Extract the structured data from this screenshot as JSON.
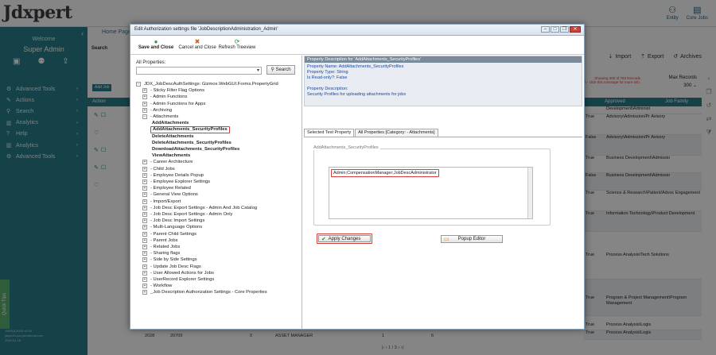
{
  "app": {
    "logo": "Jdxpert",
    "top_right": [
      {
        "icon": "entity-icon",
        "label": "Entity"
      },
      {
        "icon": "core-jobs-icon",
        "label": "Core Jobs"
      }
    ]
  },
  "sidebar": {
    "welcome": "Welcome",
    "user": "Super Admin",
    "menu": [
      {
        "label": "Advanced Tools"
      },
      {
        "label": "Actions"
      },
      {
        "label": "Search"
      },
      {
        "label": "Analytics"
      },
      {
        "label": "Help"
      },
      {
        "label": "Analytics"
      },
      {
        "label": "Advanced Tools"
      }
    ],
    "quick_tips": "Quick Tips",
    "footer": [
      "VMSQL2008 v0.00",
      "jdxpert1.jdx.jdxinternal.com",
      "2024.01.18"
    ]
  },
  "main": {
    "home_tab": "Home Page",
    "search_label": "Search",
    "add_job": "Add Job",
    "tools": [
      "Import",
      "Export",
      "Archives"
    ],
    "warning": [
      "Showing 300 of 783 Records",
      "ystem - click this message for more info."
    ],
    "max_records_label": "Max Records",
    "max_records_value": "300",
    "table_head": {
      "action": "Action",
      "approved": "Approved",
      "job_family": "Job Family"
    },
    "grid_right": [
      {
        "approved": "",
        "family": "Development\\Administ"
      },
      {
        "approved": "True",
        "family": "Advisory\\Admission/Pr Avisory"
      },
      {
        "approved": "False",
        "family": "Advisory\\Admission/Pr Avisory"
      },
      {
        "approved": "True",
        "family": "Business Development\\Admissio"
      },
      {
        "approved": "False",
        "family": "Business Development\\Admissio"
      },
      {
        "approved": "True",
        "family": "Science & Research\\Patient/Advoc Engagement"
      },
      {
        "approved": "True",
        "family": "Information Technology\\Product Development"
      },
      {
        "approved": "True",
        "family": "Process Analysis\\Tech Solutions"
      },
      {
        "approved": "True",
        "family": "Program & Project Management\\Program Management"
      },
      {
        "approved": "True",
        "family": "Process Analysis\\Logis"
      },
      {
        "approved": "True",
        "family": "Process Analysis\\Logis"
      }
    ],
    "bottom_row": {
      "c1": "2028",
      "c2": "20709",
      "c3": "0",
      "c4": "ASSET MANAGER",
      "c5": "1",
      "c6": "6"
    },
    "pager": "1 / 3"
  },
  "dialog": {
    "title": "Edit Authorization settings file 'JobDescriptionAdministration_Admin'",
    "toolbar": [
      {
        "icon": "save-icon",
        "label": "Save and Close"
      },
      {
        "icon": "cancel-icon",
        "label": "Cancel and Close"
      },
      {
        "icon": "refresh-icon",
        "label": "Refresh Treeview"
      }
    ],
    "all_properties_label": "All Properties:",
    "search_button": "Search",
    "tree_root": "JDX_JobDescAuthSettings: Gizmox.WebGUI.Forms.PropertyGrid",
    "tree": [
      {
        "label": "- Sticky Filter Flag Options"
      },
      {
        "label": "- Admin Functions"
      },
      {
        "label": "- Admin Functions for Apps"
      },
      {
        "label": "- Archiving"
      },
      {
        "label": "- Attachments"
      },
      {
        "label": "AddAttachments"
      },
      {
        "label": "AddAttachments_SecurityProfiles"
      },
      {
        "label": "DeleteAttachments"
      },
      {
        "label": "DeleteAttachments_SecurityProfiles"
      },
      {
        "label": "DownloadAttachments_SecurityProfiles"
      },
      {
        "label": "ViewAttachments"
      },
      {
        "label": "- Career Architecture"
      },
      {
        "label": "- Child Jobs"
      },
      {
        "label": "- Employee Details Popup"
      },
      {
        "label": "- Employee Explorer Settings"
      },
      {
        "label": "- Employee Related"
      },
      {
        "label": "- General View Options"
      },
      {
        "label": "- Import/Export"
      },
      {
        "label": "- Job Desc Export Settings - Admin And Job Catalog"
      },
      {
        "label": "- Job Desc Export Settings - Admin Only"
      },
      {
        "label": "- Job Desc Import Settings"
      },
      {
        "label": "- Multi-Language Options"
      },
      {
        "label": "- Parent Child Settings"
      },
      {
        "label": "- Parent Jobs"
      },
      {
        "label": "- Related Jobs"
      },
      {
        "label": "- Sharing flags"
      },
      {
        "label": "- Side by Side Settings"
      },
      {
        "label": "- Update Job Desc Flags"
      },
      {
        "label": "- User Allowed Actions for Jobs"
      },
      {
        "label": "- UserRecord Explorer Settings"
      },
      {
        "label": "- Workflow"
      },
      {
        "label": "_Job Description Authorization Settings - Core Properties"
      }
    ],
    "description": {
      "header": "Property Description for 'AddAttachments_SecurityProfiles'",
      "lines": [
        "Property Name: AddAttachments_SecurityProfiles",
        "Property Type: String",
        "Is Read-only?: False",
        "",
        "Property Description:",
        "Security Profiles for uploading attachments for jobs"
      ]
    },
    "tabs": [
      "Selected Text Property",
      "All Properties [Category: - Attachments]"
    ],
    "group_label": "AddAttachments_SecurityProfiles",
    "value": "Admin;CompensationManager;JobDescAdministrator",
    "apply_button": "Apply Changes",
    "popup_button": "Popup Editor"
  }
}
